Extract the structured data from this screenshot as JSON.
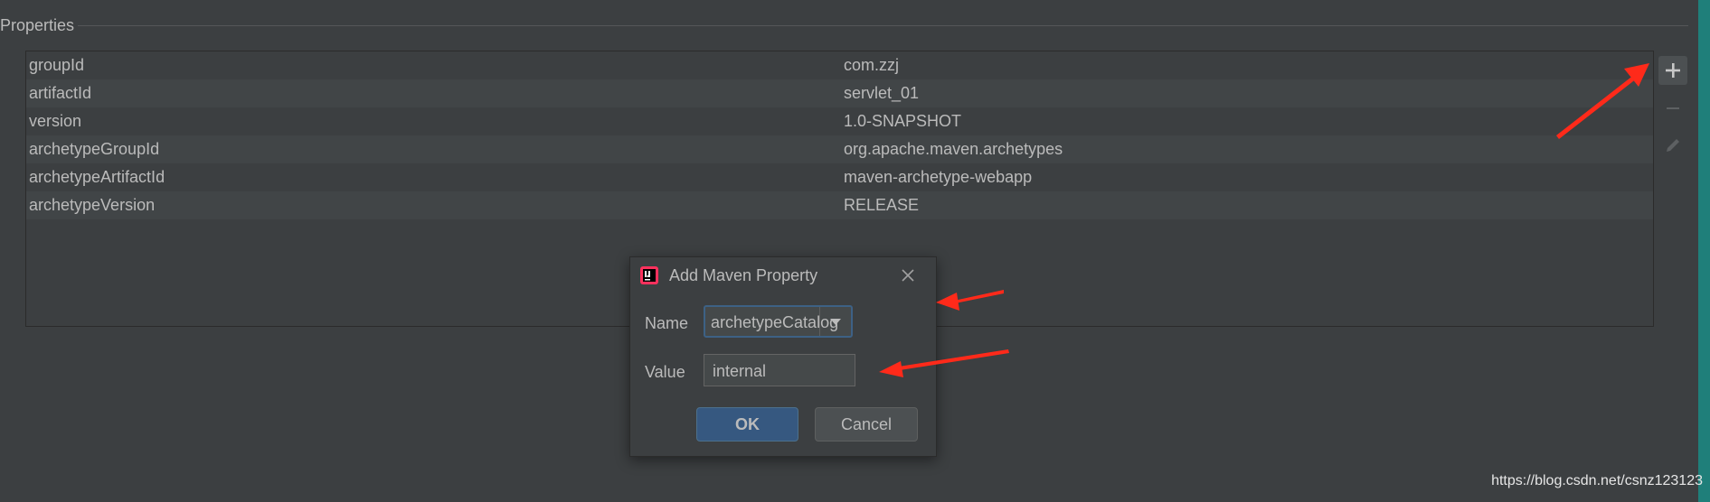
{
  "section": {
    "title": "Properties"
  },
  "properties": [
    {
      "key": "groupId",
      "value": "com.zzj"
    },
    {
      "key": "artifactId",
      "value": "servlet_01"
    },
    {
      "key": "version",
      "value": "1.0-SNAPSHOT"
    },
    {
      "key": "archetypeGroupId",
      "value": "org.apache.maven.archetypes"
    },
    {
      "key": "archetypeArtifactId",
      "value": "maven-archetype-webapp"
    },
    {
      "key": "archetypeVersion",
      "value": "RELEASE"
    }
  ],
  "toolbar": {
    "add_icon": "plus-icon",
    "remove_icon": "minus-icon",
    "edit_icon": "pencil-icon"
  },
  "dialog": {
    "title": "Add Maven Property",
    "app_icon": "intellij-idea-icon",
    "name_label": "Name",
    "name_value": "archetypeCatalog",
    "value_label": "Value",
    "value_value": "internal",
    "ok_label": "OK",
    "cancel_label": "Cancel"
  },
  "watermark": "https://blog.csdn.net/csnz123123",
  "colors": {
    "background": "#3c3f41",
    "row_alt": "#414547",
    "ok_button": "#365880",
    "focus_border": "#3d6185",
    "annotation_arrow": "#ff2a1a",
    "right_edge": "#1f7f7a"
  }
}
